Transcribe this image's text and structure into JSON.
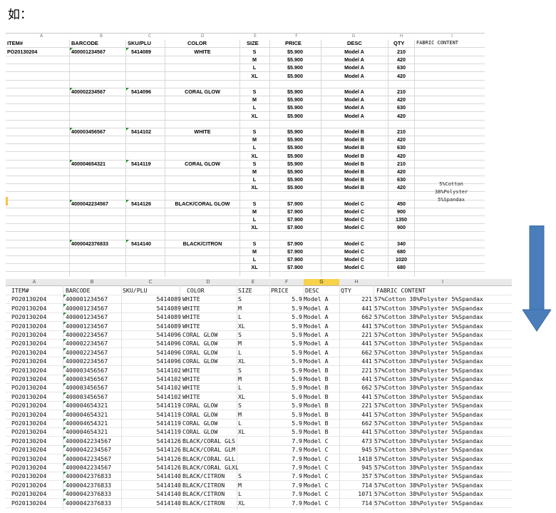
{
  "title": "如：",
  "top_sheet": {
    "col_letters": [
      "A",
      "B",
      "C",
      "D",
      "E",
      "F",
      "G",
      "H",
      "I"
    ],
    "headers": {
      "item": "ITEM#",
      "barcode": "BARCODE",
      "sku": "SKU/PLU",
      "color": "COLOR",
      "size": "SIZE",
      "price": "PRICE",
      "desc": "DESC",
      "qty": "QTY",
      "fabric": "FABRIC CONTENT"
    },
    "item_value": "PO20130204",
    "fabric_lines": [
      "5%Cotton",
      "38%Polyster",
      "5%Spandax"
    ],
    "rows": [
      {
        "barcode": "400001234567",
        "sku": "5414089",
        "color": "WHITE",
        "size": "S",
        "price": "$5.900",
        "desc": "Model A",
        "qty": "210"
      },
      {
        "size": "M",
        "price": "$5.900",
        "desc": "Model A",
        "qty": "420"
      },
      {
        "size": "L",
        "price": "$5.900",
        "desc": "Model A",
        "qty": "630"
      },
      {
        "size": "XL",
        "price": "$5.900",
        "desc": "Model A",
        "qty": "420"
      },
      {},
      {
        "barcode": "400002234567",
        "sku": "5414096",
        "color": "CORAL GLOW",
        "size": "S",
        "price": "$5.900",
        "desc": "Model A",
        "qty": "210"
      },
      {
        "size": "M",
        "price": "$5.900",
        "desc": "Model A",
        "qty": "420"
      },
      {
        "size": "L",
        "price": "$5.900",
        "desc": "Model A",
        "qty": "630"
      },
      {
        "size": "XL",
        "price": "$5.900",
        "desc": "Model A",
        "qty": "420"
      },
      {},
      {
        "barcode": "400003456567",
        "sku": "5414102",
        "color": "WHITE",
        "size": "S",
        "price": "$5.900",
        "desc": "Model B",
        "qty": "210"
      },
      {
        "size": "M",
        "price": "$5.900",
        "desc": "Model B",
        "qty": "420"
      },
      {
        "size": "L",
        "price": "$5.900",
        "desc": "Model B",
        "qty": "630"
      },
      {
        "size": "XL",
        "price": "$5.900",
        "desc": "Model B",
        "qty": "420"
      },
      {
        "barcode": "400004654321",
        "sku": "5414119",
        "color": "CORAL GLOW",
        "size": "S",
        "price": "$5.900",
        "desc": "Model B",
        "qty": "210"
      },
      {
        "size": "M",
        "price": "$5.900",
        "desc": "Model B",
        "qty": "420"
      },
      {
        "size": "L",
        "price": "$5.900",
        "desc": "Model B",
        "qty": "630"
      },
      {
        "size": "XL",
        "price": "$5.900",
        "desc": "Model B",
        "qty": "420"
      },
      {},
      {
        "barcode": "4000042234567",
        "sku": "5414126",
        "color": "BLACK/CORAL GLOW",
        "size": "S",
        "price": "$7.900",
        "desc": "Model C",
        "qty": "450"
      },
      {
        "size": "M",
        "price": "$7.900",
        "desc": "Model C",
        "qty": "900"
      },
      {
        "size": "L",
        "price": "$7.900",
        "desc": "Model C",
        "qty": "1350"
      },
      {
        "size": "XL",
        "price": "$7.900",
        "desc": "Model C",
        "qty": "900"
      },
      {},
      {
        "barcode": "4000042376833",
        "sku": "5414140",
        "color": "BLACK/CITRON",
        "size": "S",
        "price": "$7.900",
        "desc": "Model C",
        "qty": "340"
      },
      {
        "size": "M",
        "price": "$7.900",
        "desc": "Model C",
        "qty": "680"
      },
      {
        "size": "L",
        "price": "$7.900",
        "desc": "Model C",
        "qty": "1020"
      },
      {
        "size": "XL",
        "price": "$7.900",
        "desc": "Model C",
        "qty": "680"
      }
    ]
  },
  "bottom_sheet": {
    "col_letters": [
      "A",
      "B",
      "C",
      "D",
      "E",
      "F",
      "G",
      "H",
      "I"
    ],
    "headers": {
      "item": "ITEM#",
      "barcode": "BARCODE",
      "sku": "SKU/PLU",
      "color": "COLOR",
      "size": "SIZE",
      "price": "PRICE",
      "desc": "DESC",
      "qty": "QTY",
      "fabric": "FABRIC CONTENT"
    },
    "rows": [
      {
        "item": "PO20130204",
        "barcode": "400001234567",
        "sku": "5414089",
        "color": "WHITE",
        "size": "S",
        "price": "5.9",
        "desc": "Model A",
        "qty": "221",
        "fabric": "57%Cotton 38%Polyster 5%Spandax"
      },
      {
        "item": "PO20130204",
        "barcode": "400001234567",
        "sku": "5414089",
        "color": "WHITE",
        "size": "M",
        "price": "5.9",
        "desc": "Model A",
        "qty": "441",
        "fabric": "57%Cotton 38%Polyster 5%Spandax"
      },
      {
        "item": "PO20130204",
        "barcode": "400001234567",
        "sku": "5414089",
        "color": "WHITE",
        "size": "L",
        "price": "5.9",
        "desc": "Model A",
        "qty": "662",
        "fabric": "57%Cotton 38%Polyster 5%Spandax"
      },
      {
        "item": "PO20130204",
        "barcode": "400001234567",
        "sku": "5414089",
        "color": "WHITE",
        "size": "XL",
        "price": "5.9",
        "desc": "Model A",
        "qty": "441",
        "fabric": "57%Cotton 38%Polyster 5%Spandax"
      },
      {
        "item": "PO20130204",
        "barcode": "400002234567",
        "sku": "5414096",
        "color": "CORAL GLOW",
        "size": "S",
        "price": "5.9",
        "desc": "Model A",
        "qty": "221",
        "fabric": "57%Cotton 38%Polyster 5%Spandax"
      },
      {
        "item": "PO20130204",
        "barcode": "400002234567",
        "sku": "5414096",
        "color": "CORAL GLOW",
        "size": "M",
        "price": "5.9",
        "desc": "Model A",
        "qty": "441",
        "fabric": "57%Cotton 38%Polyster 5%Spandax"
      },
      {
        "item": "PO20130204",
        "barcode": "400002234567",
        "sku": "5414096",
        "color": "CORAL GLOW",
        "size": "L",
        "price": "5.9",
        "desc": "Model A",
        "qty": "662",
        "fabric": "57%Cotton 38%Polyster 5%Spandax"
      },
      {
        "item": "PO20130204",
        "barcode": "400002234567",
        "sku": "5414096",
        "color": "CORAL GLOW",
        "size": "XL",
        "price": "5.9",
        "desc": "Model A",
        "qty": "441",
        "fabric": "57%Cotton 38%Polyster 5%Spandax"
      },
      {
        "item": "PO20130204",
        "barcode": "400003456567",
        "sku": "5414102",
        "color": "WHITE",
        "size": "S",
        "price": "5.9",
        "desc": "Model B",
        "qty": "221",
        "fabric": "57%Cotton 38%Polyster 5%Spandax"
      },
      {
        "item": "PO20130204",
        "barcode": "400003456567",
        "sku": "5414102",
        "color": "WHITE",
        "size": "M",
        "price": "5.9",
        "desc": "Model B",
        "qty": "441",
        "fabric": "57%Cotton 38%Polyster 5%Spandax"
      },
      {
        "item": "PO20130204",
        "barcode": "400003456567",
        "sku": "5414102",
        "color": "WHITE",
        "size": "L",
        "price": "5.9",
        "desc": "Model B",
        "qty": "662",
        "fabric": "57%Cotton 38%Polyster 5%Spandax"
      },
      {
        "item": "PO20130204",
        "barcode": "400003456567",
        "sku": "5414102",
        "color": "WHITE",
        "size": "XL",
        "price": "5.9",
        "desc": "Model B",
        "qty": "441",
        "fabric": "57%Cotton 38%Polyster 5%Spandax"
      },
      {
        "item": "PO20130204",
        "barcode": "400004654321",
        "sku": "5414119",
        "color": "CORAL GLOW",
        "size": "S",
        "price": "5.9",
        "desc": "Model B",
        "qty": "221",
        "fabric": "57%Cotton 38%Polyster 5%Spandax"
      },
      {
        "item": "PO20130204",
        "barcode": "400004654321",
        "sku": "5414119",
        "color": "CORAL GLOW",
        "size": "M",
        "price": "5.9",
        "desc": "Model B",
        "qty": "441",
        "fabric": "57%Cotton 38%Polyster 5%Spandax"
      },
      {
        "item": "PO20130204",
        "barcode": "400004654321",
        "sku": "5414119",
        "color": "CORAL GLOW",
        "size": "L",
        "price": "5.9",
        "desc": "Model B",
        "qty": "662",
        "fabric": "57%Cotton 38%Polyster 5%Spandax"
      },
      {
        "item": "PO20130204",
        "barcode": "400004654321",
        "sku": "5414119",
        "color": "CORAL GLOW",
        "size": "XL",
        "price": "5.9",
        "desc": "Model B",
        "qty": "441",
        "fabric": "57%Cotton 38%Polyster 5%Spandax"
      },
      {
        "item": "PO20130204",
        "barcode": "4000042234567",
        "sku": "5414126",
        "color": "BLACK/CORAL GLS",
        "size": "",
        "price": "7.9",
        "desc": "Model C",
        "qty": "473",
        "fabric": "57%Cotton 38%Polyster 5%Spandax"
      },
      {
        "item": "PO20130204",
        "barcode": "4000042234567",
        "sku": "5414126",
        "color": "BLACK/CORAL GLM",
        "size": "",
        "price": "7.9",
        "desc": "Model C",
        "qty": "945",
        "fabric": "57%Cotton 38%Polyster 5%Spandax"
      },
      {
        "item": "PO20130204",
        "barcode": "4000042234567",
        "sku": "5414126",
        "color": "BLACK/CORAL GLL",
        "size": "",
        "price": "7.9",
        "desc": "Model C",
        "qty": "1418",
        "fabric": "57%Cotton 38%Polyster 5%Spandax"
      },
      {
        "item": "PO20130204",
        "barcode": "4000042234567",
        "sku": "5414126",
        "color": "BLACK/CORAL GLXL",
        "size": "",
        "price": "7.9",
        "desc": "Model C",
        "qty": "945",
        "fabric": "57%Cotton 38%Polyster 5%Spandax"
      },
      {
        "item": "PO20130204",
        "barcode": "4000042376833",
        "sku": "5414140",
        "color": "BLACK/CITRON",
        "size": "S",
        "price": "7.9",
        "desc": "Model C",
        "qty": "357",
        "fabric": "57%Cotton 38%Polyster 5%Spandax"
      },
      {
        "item": "PO20130204",
        "barcode": "4000042376833",
        "sku": "5414140",
        "color": "BLACK/CITRON",
        "size": "M",
        "price": "7.9",
        "desc": "Model C",
        "qty": "714",
        "fabric": "57%Cotton 38%Polyster 5%Spandax"
      },
      {
        "item": "PO20130204",
        "barcode": "4000042376833",
        "sku": "5414140",
        "color": "BLACK/CITRON",
        "size": "L",
        "price": "7.9",
        "desc": "Model C",
        "qty": "1071",
        "fabric": "57%Cotton 38%Polyster 5%Spandax"
      },
      {
        "item": "PO20130204",
        "barcode": "4000042376833",
        "sku": "5414140",
        "color": "BLACK/CITRON",
        "size": "XL",
        "price": "7.9",
        "desc": "Model C",
        "qty": "714",
        "fabric": "57%Cotton 38%Polyster 5%Spandax"
      }
    ]
  },
  "colors": {
    "arrow": "#4a7ebb",
    "barcode_marker": "#1f8f3a",
    "active_col": "#f7d24a"
  }
}
